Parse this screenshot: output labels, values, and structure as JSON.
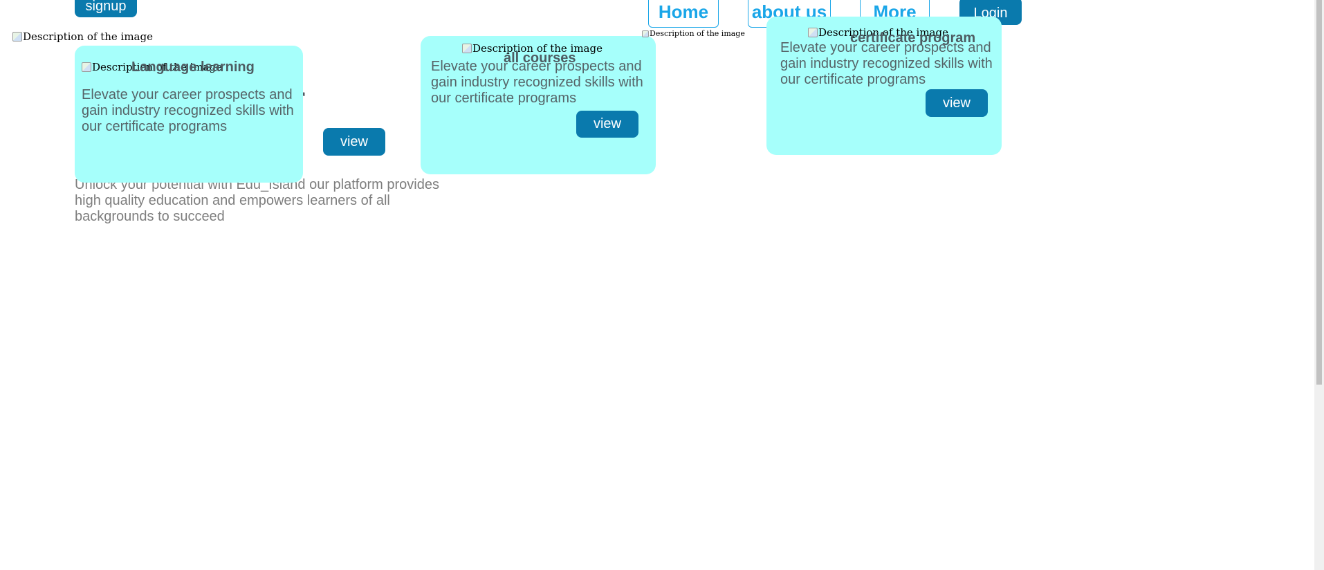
{
  "header": {
    "signup_label": "signup",
    "login_label": "Login",
    "nav": [
      {
        "label": "Home"
      },
      {
        "label": "about us"
      },
      {
        "label": "More"
      }
    ],
    "logo_alt": "Description of the image",
    "nav_image_alt": "Description of the image"
  },
  "hero": {
    "title_fragment": "r",
    "description": "Unlock your potential with Edu_Island our platform provides high quality education and empowers learners of all backgrounds to succeed",
    "view_label": "view"
  },
  "cards": [
    {
      "image_alt": "Description of the image",
      "title": "Language learning",
      "text": "Elevate your career prospects and gain industry recognized skills with our certificate programs",
      "view_label": ""
    },
    {
      "image_alt": "Description of the image",
      "title": "all courses",
      "text": "Elevate your career prospects and gain industry recognized skills with our certificate programs",
      "view_label": "view"
    },
    {
      "image_alt": "Description of the image",
      "title": "certificate program",
      "text": "Elevate your career prospects and gain industry recognized skills with our certificate programs",
      "view_label": "view"
    }
  ],
  "colors": {
    "card_background": "#a6fffb",
    "button_background": "#0a7aad",
    "nav_accent": "#1aa6e8"
  }
}
